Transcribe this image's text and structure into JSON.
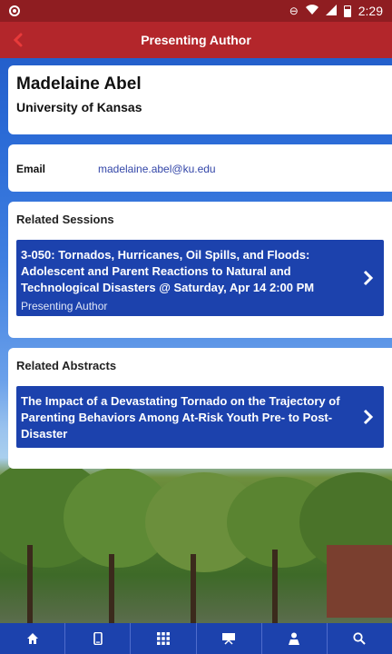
{
  "status_bar": {
    "time": "2:29"
  },
  "header": {
    "title": "Presenting Author"
  },
  "author": {
    "name": "Madelaine Abel",
    "organization": "University of Kansas"
  },
  "contact": {
    "email_label": "Email",
    "email_value": "madelaine.abel@ku.edu"
  },
  "related_sessions": {
    "title": "Related Sessions",
    "items": [
      {
        "title": "3-050: Tornados, Hurricanes, Oil Spills, and Floods: Adolescent and Parent Reactions to Natural and Technological Disasters @ Saturday, Apr 14 2:00 PM",
        "subtitle": "Presenting Author"
      }
    ]
  },
  "related_abstracts": {
    "title": "Related Abstracts",
    "items": [
      {
        "title": "The Impact of a Devastating Tornado on the Trajectory of Parenting Behaviors Among At-Risk Youth Pre- to Post-Disaster"
      }
    ]
  },
  "bottom_nav": {
    "items": [
      "home-icon",
      "phone-icon",
      "grid-icon",
      "presentation-icon",
      "person-icon",
      "search-icon"
    ]
  },
  "colors": {
    "status_bar": "#8f1d21",
    "header": "#b3262b",
    "item_blue": "#1c42ad",
    "link": "#3346a8"
  }
}
